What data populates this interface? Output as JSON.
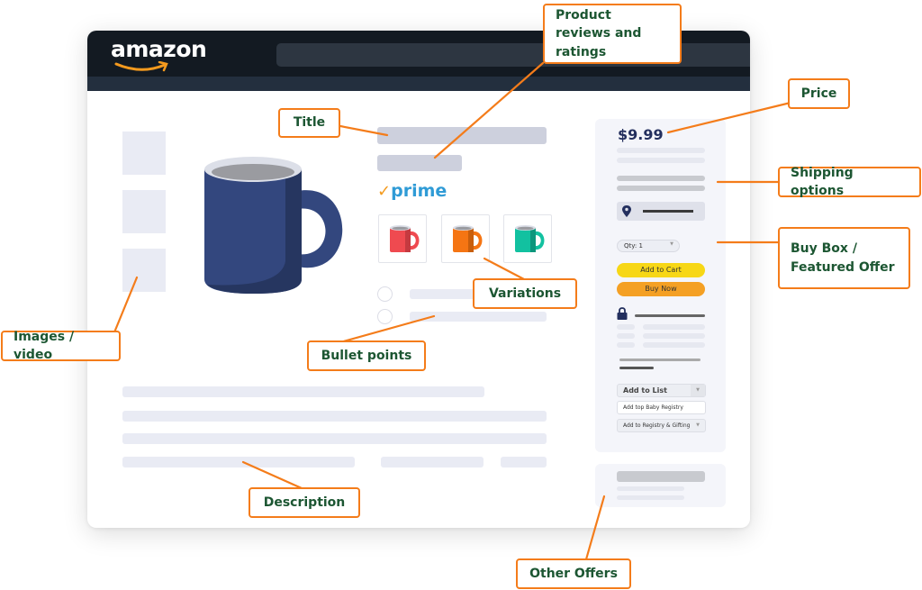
{
  "header": {
    "logo_text": "amazon",
    "search_placeholder": ""
  },
  "product": {
    "prime_label": "prime",
    "prime_check": "✓",
    "variations": [
      {
        "color_name": "red",
        "body": "#ef4a50",
        "shade": "#c53a40"
      },
      {
        "color_name": "orange",
        "body": "#f57513",
        "shade": "#c85e0c"
      },
      {
        "color_name": "teal",
        "body": "#12c1a0",
        "shade": "#0c967c"
      }
    ],
    "main_image_colors": {
      "body": "#33477e",
      "shade": "#263660",
      "rim": "#dcdfe8",
      "coffee": "#9a9ba0"
    }
  },
  "buybox": {
    "price": "$9.99",
    "qty_label": "Qty: 1",
    "add_to_cart": "Add to Cart",
    "buy_now": "Buy Now",
    "add_to_list": "Add to List",
    "baby_registry": "Add top Baby Registry",
    "registry_gifting": "Add to Registry & Gifting",
    "caret": "▼"
  },
  "callouts": {
    "reviews": "Product reviews and ratings",
    "title": "Title",
    "price": "Price",
    "shipping": "Shipping options",
    "buybox": "Buy Box / Featured Offer",
    "variations": "Variations",
    "images": "Images / video",
    "bullets": "Bullet points",
    "description": "Description",
    "other_offers": "Other Offers"
  },
  "colors": {
    "accent_orange": "#f47c1a",
    "label_green": "#1c5632",
    "nav_dark": "#131a22",
    "add_to_cart_yellow": "#f7d716",
    "buy_now_orange": "#f4a024"
  }
}
